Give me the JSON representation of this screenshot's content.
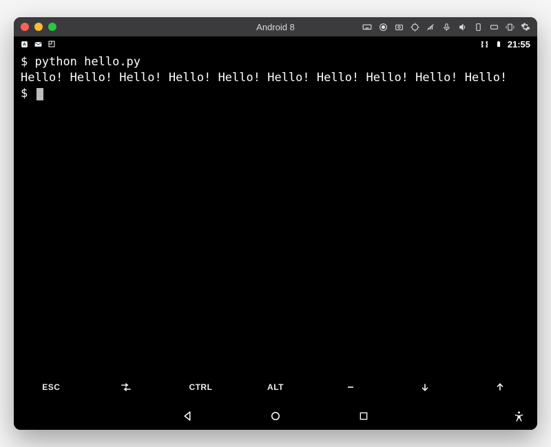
{
  "titlebar": {
    "title": "Android 8"
  },
  "statusbar": {
    "clock": "21:55"
  },
  "terminal": {
    "prompt": "$",
    "command": "python hello.py",
    "output": "Hello! Hello! Hello! Hello! Hello! Hello! Hello! Hello! Hello! Hello!"
  },
  "keys": {
    "esc": "ESC",
    "ctrl": "CTRL",
    "alt": "ALT"
  }
}
